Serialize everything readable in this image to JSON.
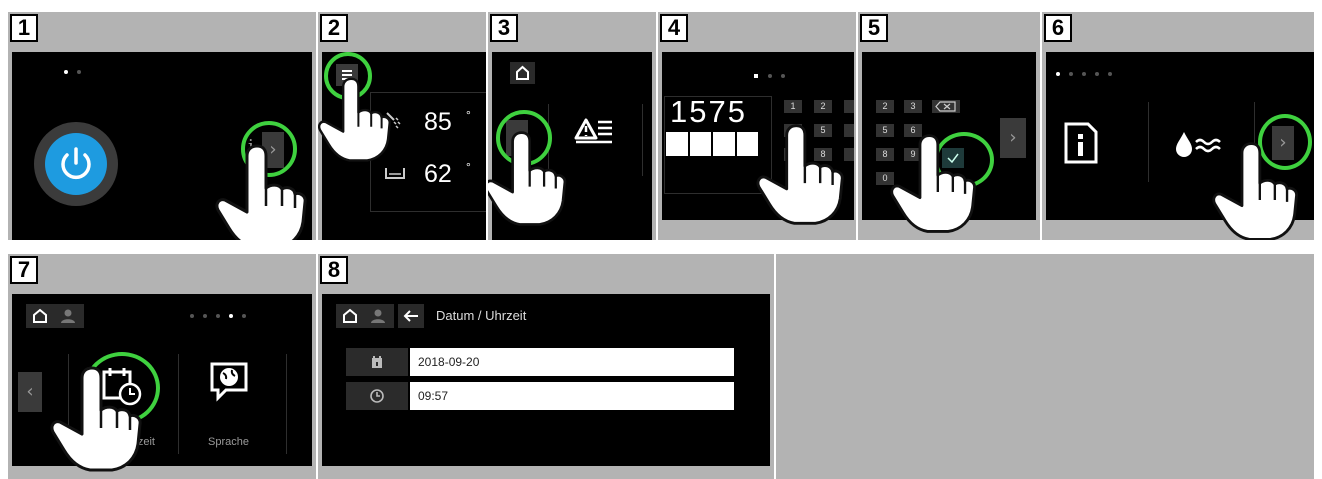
{
  "steps": [
    {
      "number": "1"
    },
    {
      "number": "2",
      "temps": {
        "shower": "85",
        "bath": "62",
        "unit": "°"
      }
    },
    {
      "number": "3"
    },
    {
      "number": "4",
      "code": "1575",
      "keys": [
        "1",
        "2",
        "4",
        "5",
        "7",
        "8"
      ]
    },
    {
      "number": "5",
      "keys": [
        "2",
        "3",
        "5",
        "6",
        "8",
        "9",
        "0"
      ]
    },
    {
      "number": "6"
    },
    {
      "number": "7",
      "tiles": {
        "datetime_label": "/ Uhrzeit",
        "language_label": "Sprache"
      }
    },
    {
      "number": "8",
      "title": "Datum / Uhrzeit",
      "date_value": "2018-09-20",
      "time_value": "09:57"
    }
  ],
  "colors": {
    "highlight": "#3fd13f",
    "power": "#1e9be0",
    "panel": "#b3b3b3",
    "screen": "#000000"
  },
  "icons": [
    "power-icon",
    "info-icon",
    "menu-icon",
    "home-icon",
    "user-icon",
    "back-arrow-icon",
    "calendar-icon",
    "clock-icon",
    "globe-speech-icon",
    "warning-list-icon",
    "water-drop-icon",
    "shower-icon",
    "bathtub-icon",
    "backspace-icon",
    "check-icon",
    "chevron-left-icon",
    "chevron-right-icon",
    "pointing-hand-icon"
  ]
}
